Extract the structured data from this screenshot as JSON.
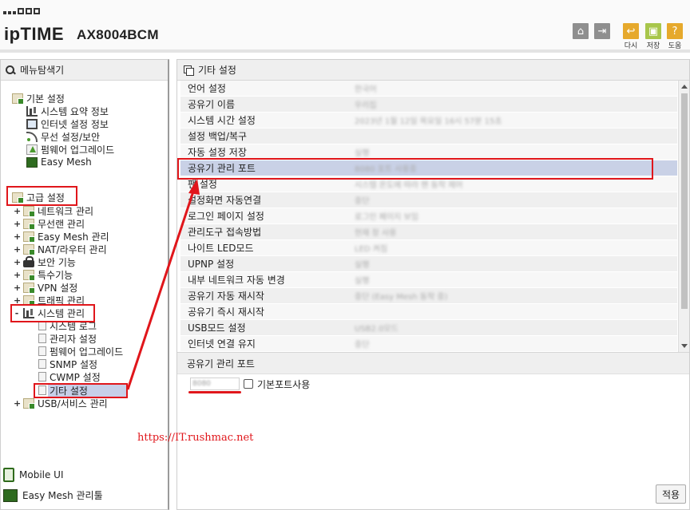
{
  "header": {
    "brand": "ipTIME",
    "model": "AX8004BCM",
    "buttons": [
      {
        "icon": "home-icon",
        "label": ""
      },
      {
        "icon": "logout-icon",
        "label": ""
      },
      {
        "icon": "back-icon",
        "label": "다시"
      },
      {
        "icon": "save-icon",
        "label": "저장"
      },
      {
        "icon": "help-icon",
        "label": "도움"
      }
    ]
  },
  "sidebar": {
    "title": "메뉴탐색기",
    "basic_group": "기본 설정",
    "basic_items": [
      "시스템 요약 정보",
      "인터넷 설정 정보",
      "무선 설정/보안",
      "펌웨어 업그레이드",
      "Easy Mesh"
    ],
    "advanced_group": "고급 설정",
    "advanced_items": [
      "네트워크 관리",
      "무선랜 관리",
      "Easy Mesh 관리",
      "NAT/라우터 관리",
      "보안 기능",
      "특수기능",
      "VPN 설정",
      "트래픽 관리"
    ],
    "system_group": "시스템 관리",
    "system_items": [
      "시스템 로그",
      "관리자 설정",
      "펌웨어 업그레이드",
      "SNMP 설정",
      "CWMP 설정",
      "기타 설정"
    ],
    "usb_group": "USB/서비스 관리",
    "mobile_ui": "Mobile UI",
    "easy_mesh_tool": "Easy Mesh 관리툴",
    "expanded_sign": "-",
    "collapsed_sign": "+"
  },
  "main": {
    "title": "기타 설정",
    "rows": [
      {
        "label": "언어 설정",
        "value": "한국어"
      },
      {
        "label": "공유기 이름",
        "value": "우리집"
      },
      {
        "label": "시스템 시간 설정",
        "value": "2023년 1월 12일 목요일 16시 57분 15초"
      },
      {
        "label": "설정 백업/복구",
        "value": ""
      },
      {
        "label": "자동 설정 저장",
        "value": "실행"
      },
      {
        "label": "공유기 관리 포트",
        "value": "8080 포트 사용중"
      },
      {
        "label": "팬 설정",
        "value": "시스템 온도에 따라 팬 동작 제어"
      },
      {
        "label": "설정화면 자동연결",
        "value": "중단"
      },
      {
        "label": "로그인 페이지 설정",
        "value": "로그인 페이지 보임"
      },
      {
        "label": "관리도구 접속방법",
        "value": "현재 창 사용"
      },
      {
        "label": "나이트 LED모드",
        "value": "LED 켜짐"
      },
      {
        "label": "UPNP 설정",
        "value": "실행"
      },
      {
        "label": "내부 네트워크 자동 변경",
        "value": "실행"
      },
      {
        "label": "공유기 자동 재시작",
        "value": "중단 (Easy Mesh 동작 중)"
      },
      {
        "label": "공유기 즉시 재시작",
        "value": ""
      },
      {
        "label": "USB모드 설정",
        "value": "USB2.0모드"
      },
      {
        "label": "인터넷 연결 유지",
        "value": "중단"
      }
    ],
    "highlighted_row": 5,
    "sub_title": "공유기 관리 포트",
    "port_value": "8080",
    "default_port_label": "기본포트사용",
    "apply_label": "적용"
  },
  "watermark": "https://IT.rushmac.net",
  "colors": {
    "annotation_red": "#e0161b",
    "selection": "#c7cfe8"
  }
}
